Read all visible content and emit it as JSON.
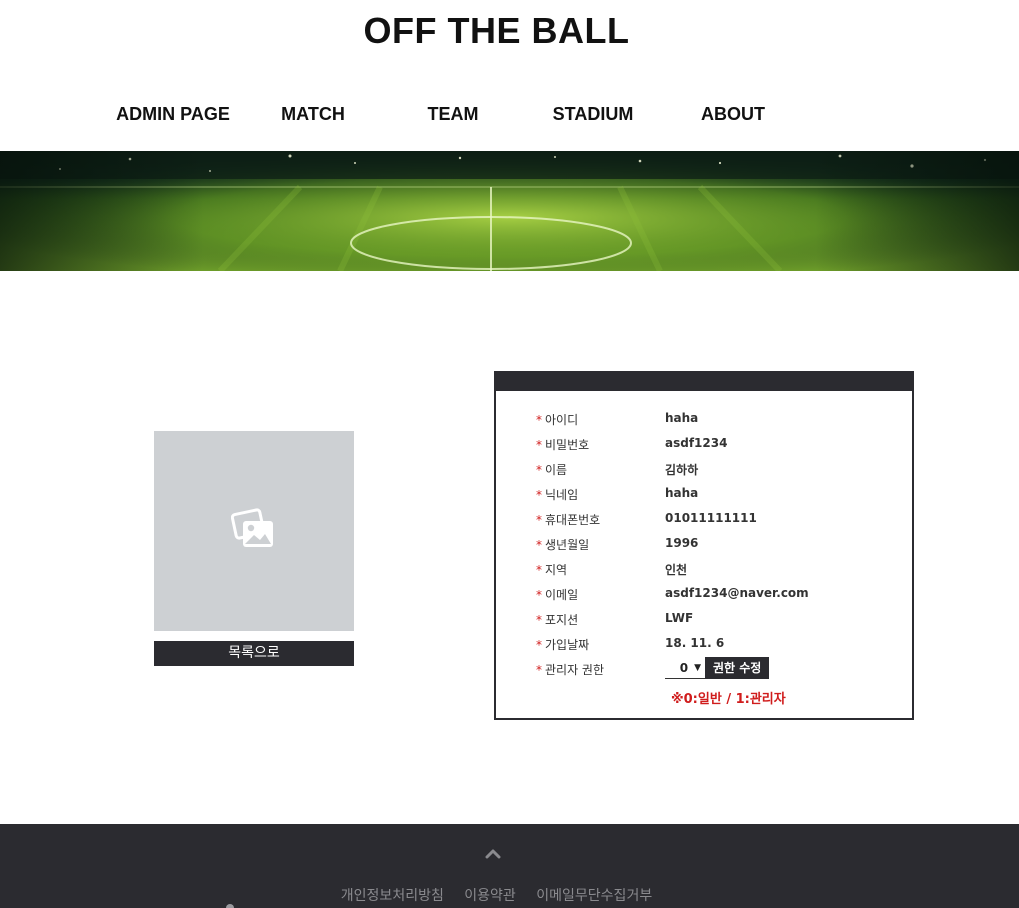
{
  "site": {
    "title": "OFF THE BALL"
  },
  "nav": {
    "items": [
      {
        "label": "ADMIN PAGE"
      },
      {
        "label": "MATCH"
      },
      {
        "label": "TEAM"
      },
      {
        "label": "STADIUM"
      },
      {
        "label": "ABOUT"
      }
    ]
  },
  "banner": {
    "image": "football-stadium-pitch"
  },
  "profile": {
    "photo_icon": "images-placeholder-icon",
    "back_label": "목록으로"
  },
  "member": {
    "fields": [
      {
        "label": "아이디",
        "value": "haha"
      },
      {
        "label": "비밀번호",
        "value": "asdf1234"
      },
      {
        "label": "이름",
        "value": "김하하"
      },
      {
        "label": "닉네임",
        "value": "haha"
      },
      {
        "label": "휴대폰번호",
        "value": "01011111111"
      },
      {
        "label": "생년월일",
        "value": "1996"
      },
      {
        "label": "지역",
        "value": "인천"
      },
      {
        "label": "이메일",
        "value": "asdf1234@naver.com"
      },
      {
        "label": "포지션",
        "value": "LWF"
      },
      {
        "label": "가입날짜",
        "value": "18. 11. 6"
      }
    ],
    "required_mark": "*",
    "authority": {
      "label": "관리자 권한",
      "selected": "0",
      "button_label": "권한 수정",
      "note": "※0:일반 / 1:관리자"
    }
  },
  "footer": {
    "links": [
      {
        "label": "개인정보처리방침"
      },
      {
        "label": "이용약관"
      },
      {
        "label": "이메일무단수집거부"
      }
    ]
  },
  "colors": {
    "dark": "#2b2b30",
    "accent_red": "#d01c1c",
    "placeholder_gray": "#cdd0d3"
  }
}
